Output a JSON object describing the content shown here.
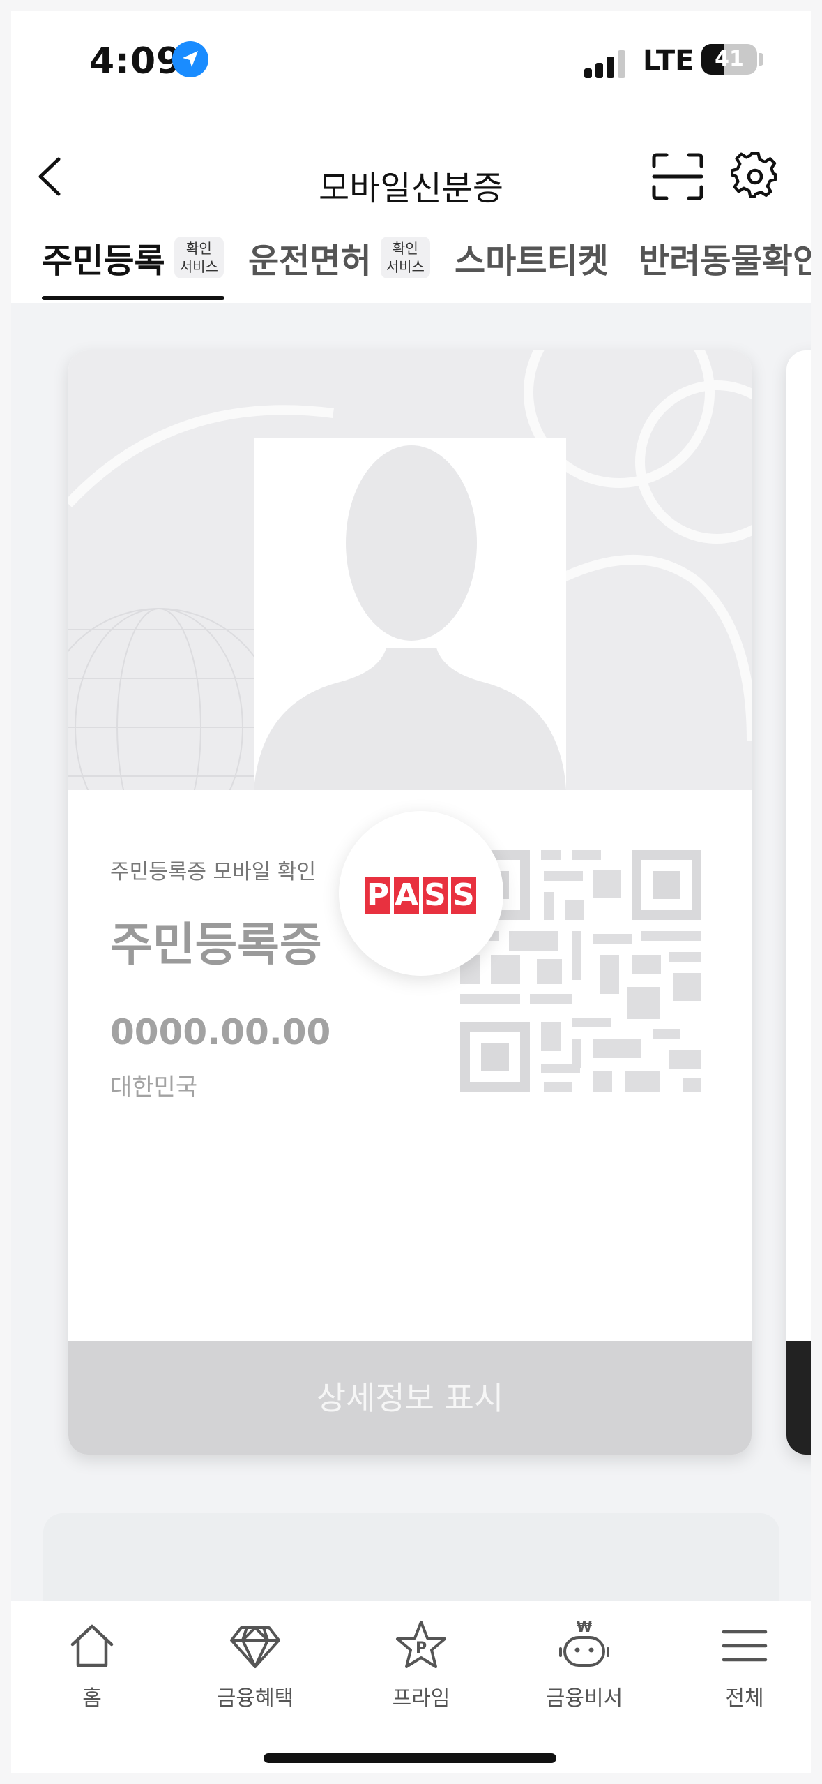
{
  "status_bar": {
    "time": "4:09",
    "network": "LTE",
    "battery_level": "41",
    "battery_fraction": 0.41,
    "icons": [
      "location-arrow-icon",
      "signal-bars-icon",
      "battery-icon"
    ]
  },
  "nav": {
    "title": "모바일신분증",
    "icons": [
      "back-chevron-icon",
      "scan-frame-icon",
      "gear-icon"
    ]
  },
  "tabs": [
    {
      "label": "주민등록",
      "badge_line1": "확인",
      "badge_line2": "서비스",
      "active": true
    },
    {
      "label": "운전면허",
      "badge_line1": "확인",
      "badge_line2": "서비스",
      "active": false
    },
    {
      "label": "스마트티켓",
      "active": false
    },
    {
      "label": "반려동물확인",
      "active": false
    }
  ],
  "card": {
    "subtitle": "주민등록증 모바일 확인",
    "title": "주민등록증",
    "date": "0000.00.00",
    "country": "대한민국",
    "pass_logo_letters": [
      "P",
      "A",
      "S",
      "S"
    ],
    "detail_button": "상세정보 표시",
    "colors": {
      "pass_red": "#e8313f",
      "placeholder_gray": "#a2a2a2"
    }
  },
  "tab_bar": [
    {
      "label": "홈",
      "icon": "home-icon"
    },
    {
      "label": "금융혜택",
      "icon": "diamond-icon"
    },
    {
      "label": "프라임",
      "icon": "star-p-icon"
    },
    {
      "label": "금융비서",
      "icon": "robot-won-icon"
    },
    {
      "label": "전체",
      "icon": "menu-icon"
    }
  ]
}
